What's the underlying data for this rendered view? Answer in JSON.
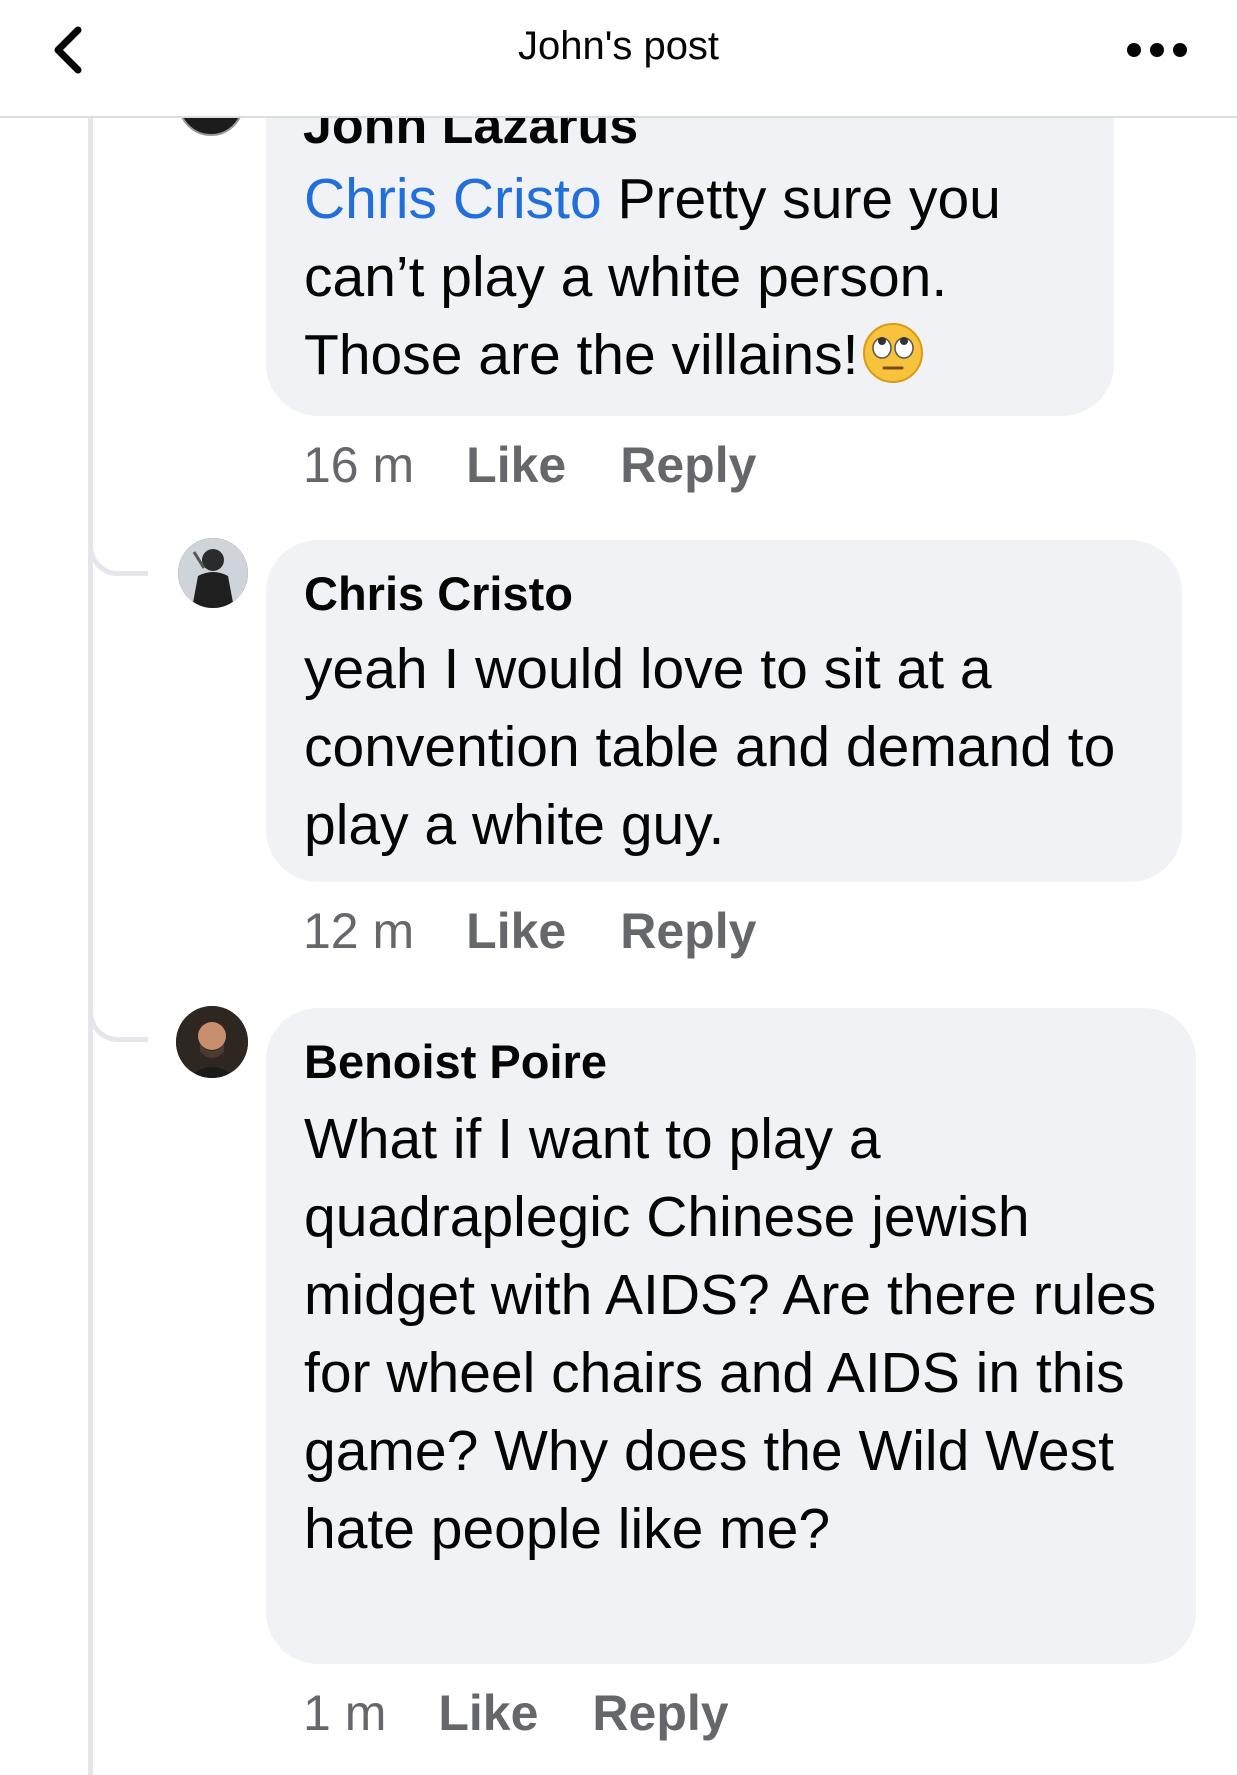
{
  "header": {
    "title": "John's post"
  },
  "comments": [
    {
      "author": "John Lazarus",
      "mention": "Chris Cristo",
      "text": " Pretty sure you can’t play a white person. Those are the villains!",
      "emoji": "face-with-rolling-eyes-emoji",
      "time": "16 m",
      "like_label": "Like",
      "reply_label": "Reply"
    },
    {
      "author": "Chris Cristo",
      "text": "yeah I would love to sit at a convention table and demand to play a white guy.",
      "time": "12 m",
      "like_label": "Like",
      "reply_label": "Reply"
    },
    {
      "author": "Benoist Poire",
      "text": "What if I want to play a quadraplegic Chinese jewish midget with AIDS? Are there rules for wheel chairs and AIDS in this game? Why does the Wild West hate people like me?",
      "time": "1 m",
      "like_label": "Like",
      "reply_label": "Reply"
    }
  ],
  "colors": {
    "mention": "#216fdb",
    "bubble": "#f0f2f5",
    "meta": "#65676b",
    "thread_line": "#e4e6eb"
  }
}
